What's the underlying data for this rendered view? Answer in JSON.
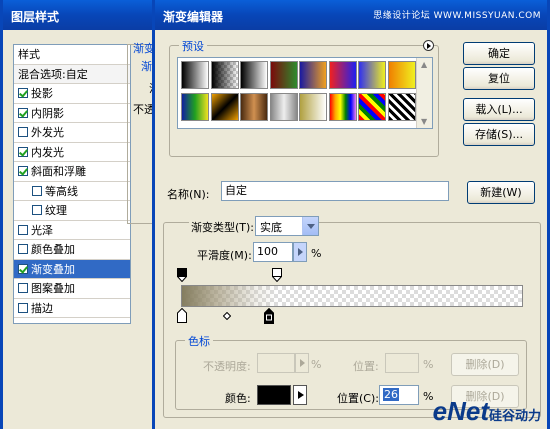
{
  "layer_style": {
    "title": "图层样式",
    "list_items": [
      {
        "label": "样式",
        "kind": "head"
      },
      {
        "label": "混合选项:自定",
        "kind": "blend"
      },
      {
        "label": "投影",
        "checked": true
      },
      {
        "label": "内阴影",
        "checked": true
      },
      {
        "label": "外发光",
        "checked": false
      },
      {
        "label": "内发光",
        "checked": true
      },
      {
        "label": "斜面和浮雕",
        "checked": true
      },
      {
        "label": "等高线",
        "checked": false,
        "indent": true
      },
      {
        "label": "纹理",
        "checked": false,
        "indent": true
      },
      {
        "label": "光泽",
        "checked": false
      },
      {
        "label": "颜色叠加",
        "checked": false
      },
      {
        "label": "渐变叠加",
        "checked": true,
        "selected": true
      },
      {
        "label": "图案叠加",
        "checked": false
      },
      {
        "label": "描边",
        "checked": false
      }
    ],
    "frag_top": "渐变",
    "frag_sub": "渐",
    "frag_1": "混",
    "frag_2": "不透"
  },
  "gradient_editor": {
    "title": "渐变编辑器",
    "watermark": "思缘设计论坛 WWW.MISSYUAN.COM",
    "presets_label": "预设",
    "buttons": {
      "ok": "确定",
      "reset": "复位",
      "load": "载入(L)...",
      "save": "存储(S)...",
      "new": "新建(W)"
    },
    "name_label": "名称(N):",
    "name_value": "自定",
    "gradient_type_label": "渐变类型(T):",
    "gradient_type_value": "实底",
    "smoothness_label": "平滑度(M):",
    "smoothness_value": "100",
    "percent": "%",
    "stops": {
      "group_label": "色标",
      "opacity_label": "不透明度:",
      "location_label_disabled": "位置:",
      "delete_label": "删除(D)",
      "color_label": "颜色:",
      "location_label": "位置(C):",
      "location_value": "26"
    },
    "logo": "eNet",
    "logo_sub": "硅谷动力"
  },
  "colors": {
    "title_bar": "#0846b8",
    "selection": "#316ac5",
    "group_label": "#0046d5",
    "stop_color": "#000000"
  }
}
